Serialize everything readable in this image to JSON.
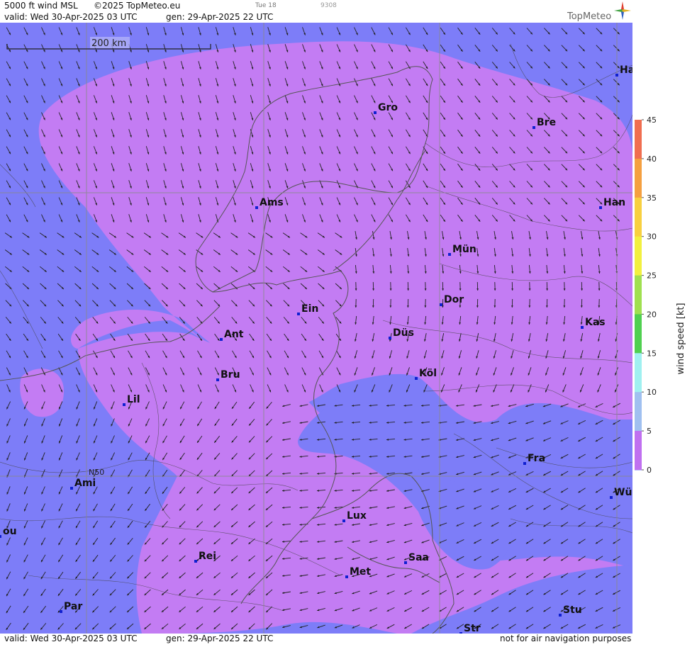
{
  "header": {
    "product": "5000 ft wind MSL",
    "copyright": "©2025 TopMeteo.eu",
    "tag": "Tue 18",
    "code": "9308",
    "valid": "valid:  Wed  30-Apr-2025  03 UTC",
    "gen": "gen: 29-Apr-2025 22 UTC",
    "logo_text": "TopMeteo"
  },
  "footer": {
    "valid": "valid:  Wed  30-Apr-2025  03 UTC",
    "gen": "gen: 29-Apr-2025 22 UTC",
    "note": "not for air navigation purposes"
  },
  "scale_label": "200 km",
  "lat_label": "N50",
  "legend": {
    "title": "wind  speed  [kt]",
    "ticks": [
      "45",
      "40",
      "35",
      "30",
      "25",
      "20",
      "15",
      "10",
      "5",
      "0"
    ],
    "colors": [
      "#f06e50",
      "#f5a040",
      "#f8d040",
      "#f2f040",
      "#a0e050",
      "#50d050",
      "#a0f0f0",
      "#a0c0f0",
      "#7878f8",
      "#c070f0"
    ]
  },
  "cities": [
    {
      "name": "Ha"
    },
    {
      "name": "Gro"
    },
    {
      "name": "Bre"
    },
    {
      "name": "Ams"
    },
    {
      "name": "Han"
    },
    {
      "name": "Mün"
    },
    {
      "name": "Ein"
    },
    {
      "name": "Dor"
    },
    {
      "name": "Ant"
    },
    {
      "name": "Düs"
    },
    {
      "name": "Kas"
    },
    {
      "name": "Bru"
    },
    {
      "name": "Köl"
    },
    {
      "name": "Lil"
    },
    {
      "name": "Fra"
    },
    {
      "name": "Ami"
    },
    {
      "name": "Wü"
    },
    {
      "name": "Lux"
    },
    {
      "name": "ou"
    },
    {
      "name": "Rei"
    },
    {
      "name": "Saa"
    },
    {
      "name": "Met"
    },
    {
      "name": "Par"
    },
    {
      "name": "Stu"
    },
    {
      "name": "Str"
    }
  ],
  "colors": {
    "blue_zone": "#7d7df8",
    "purple_zone": "#c37cf3",
    "grid": "#8a8a8a",
    "border": "#5a5a5a"
  }
}
